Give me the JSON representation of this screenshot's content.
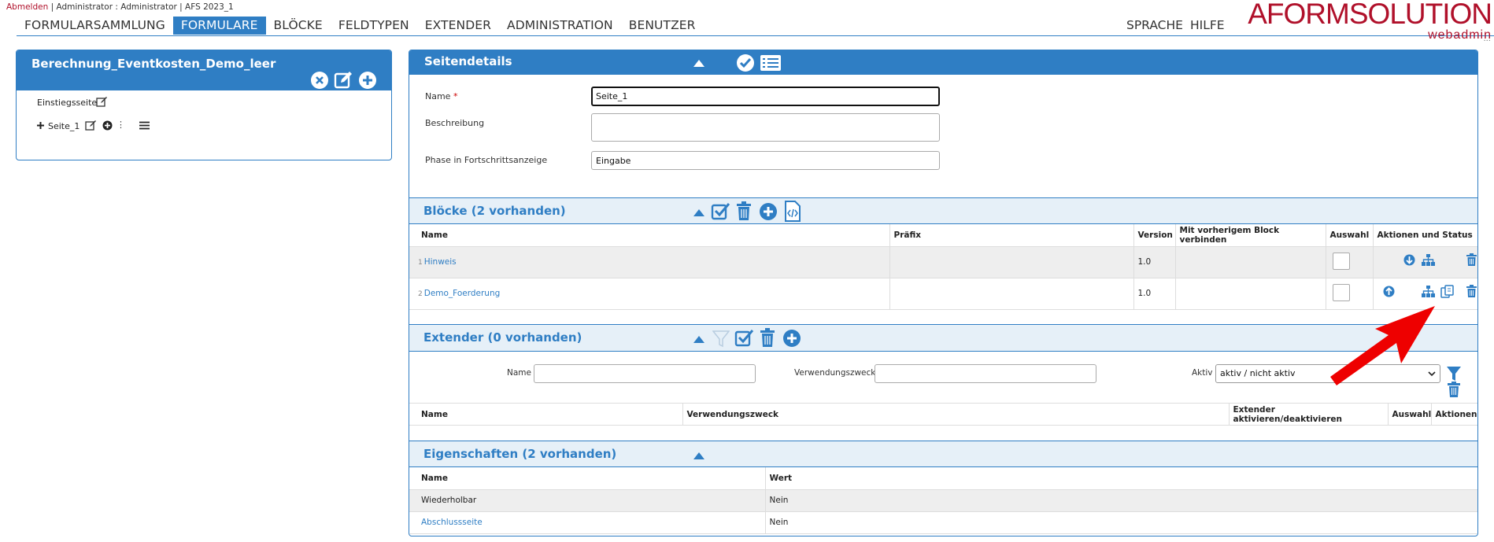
{
  "topbar": {
    "logout": "Abmelden",
    "info": " | Administrator : Administrator | AFS 2023_1"
  },
  "nav": {
    "items": [
      "FORMULARSAMMLUNG",
      "FORMULARE",
      "BLÖCKE",
      "FELDTYPEN",
      "EXTENDER",
      "ADMINISTRATION",
      "BENUTZER"
    ],
    "active": "FORMULARE",
    "right": [
      "SPRACHE",
      "HILFE"
    ]
  },
  "logo": {
    "a": "AFORM",
    "b": "SOLUTION",
    "sub": "webadmin",
    "dots": "..."
  },
  "tree": {
    "title": "Berechnung_Eventkosten_Demo_leer",
    "entry": "Einstiegsseite",
    "page": "Seite_1",
    "kebab": "⋮"
  },
  "details": {
    "title": "Seitendetails",
    "name_label": "Name",
    "required": "*",
    "name_value": "Seite_1",
    "desc_label": "Beschreibung",
    "desc_value": "",
    "phase_label": "Phase in Fortschrittsanzeige",
    "phase_value": "Eingabe"
  },
  "blocks": {
    "title": "Blöcke (2 vorhanden)",
    "headers": [
      "Name",
      "Präfix",
      "Version",
      "Mit vorherigem Block verbinden",
      "Auswahl",
      "Aktionen und Status"
    ],
    "rows": [
      {
        "num": "1",
        "name": "Hinweis",
        "prefix": "",
        "version": "1.0"
      },
      {
        "num": "2",
        "name": "Demo_Foerderung",
        "prefix": "",
        "version": "1.0"
      }
    ]
  },
  "extender": {
    "title": "Extender (0 vorhanden)",
    "filter_name": "Name",
    "filter_purpose": "Verwendungszweck",
    "filter_active": "Aktiv",
    "active_option": "aktiv / nicht aktiv",
    "headers": [
      "Name",
      "Verwendungszweck",
      "Extender aktivieren/deaktivieren",
      "Auswahl",
      "Aktionen"
    ]
  },
  "properties": {
    "title": "Eigenschaften (2 vorhanden)",
    "headers": [
      "Name",
      "Wert"
    ],
    "rows": [
      {
        "name": "Wiederholbar",
        "value": "Nein"
      },
      {
        "name": "Abschlussseite",
        "value": "Nein"
      }
    ]
  },
  "colors": {
    "accent": "#2f7ec4",
    "brand": "#b0102a",
    "arrow": "#ee0000"
  }
}
